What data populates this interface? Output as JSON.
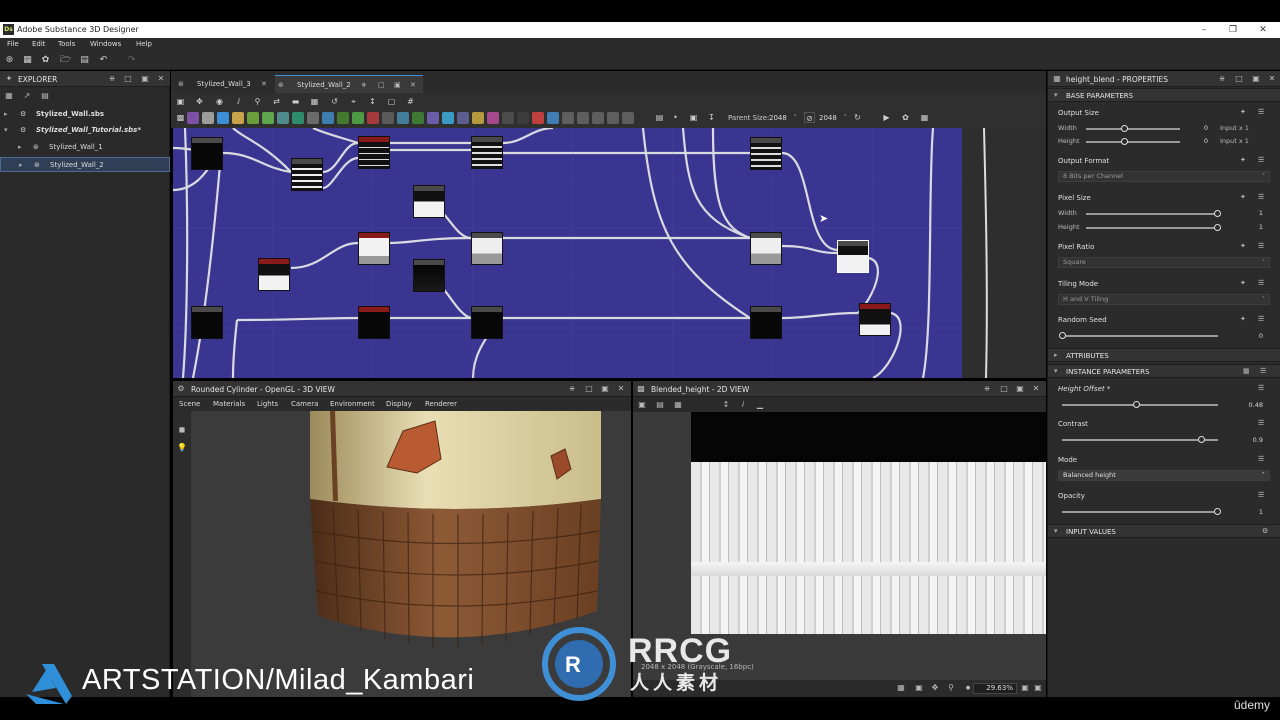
{
  "app": {
    "title": "Adobe Substance 3D Designer",
    "logo": "Ds"
  },
  "menu": [
    "File",
    "Edit",
    "Tools",
    "Windows",
    "Help"
  ],
  "explorer": {
    "title": "EXPLORER",
    "items": [
      {
        "label": "Stylized_Wall.sbs"
      },
      {
        "label": "Stylized_Wall_Tutorial.sbs*"
      },
      {
        "label": "Stylized_Wall_1"
      },
      {
        "label": "Stylized_Wall_2"
      }
    ]
  },
  "graph": {
    "tabs": [
      "Stylized_Wall_3",
      "Stylized_Wall_2"
    ],
    "parent_size_label": "Parent Size:",
    "parent_size_value": "2048",
    "size_value": "2048",
    "canvas_color": "#3a3590"
  },
  "view3d": {
    "title": "Rounded Cylinder - OpenGL - 3D VIEW",
    "menu": [
      "Scene",
      "Materials",
      "Lights",
      "Camera",
      "Environment",
      "Display",
      "Renderer"
    ]
  },
  "view2d": {
    "title": "Blended_height - 2D VIEW",
    "status": "2048 x 2048 (Grayscale, 16bpc)",
    "zoom": "29.63%"
  },
  "properties": {
    "title": "height_blend - PROPERTIES",
    "base_parameters": "BASE PARAMETERS",
    "output_size": {
      "label": "Output Size",
      "width_label": "Width",
      "width_value": "0",
      "width_mode": "Input x 1",
      "width_level": 0.5,
      "height_label": "Height",
      "height_value": "0",
      "height_mode": "Input x 1",
      "height_level": 0.5
    },
    "output_format": {
      "label": "Output Format",
      "value": "8 Bits per Channel"
    },
    "pixel_size": {
      "label": "Pixel Size",
      "width_label": "Width",
      "width_value": "1",
      "width_level": 1.0,
      "height_label": "Height",
      "height_value": "1",
      "height_level": 1.0
    },
    "pixel_ratio": {
      "label": "Pixel Ratio",
      "value": "Square"
    },
    "tiling_mode": {
      "label": "Tiling Mode",
      "value": "H and V Tiling"
    },
    "random_seed": {
      "label": "Random Seed",
      "value": "0",
      "level": 0.0
    },
    "attributes": "ATTRIBUTES",
    "instance_parameters": "INSTANCE PARAMETERS",
    "height_offset": {
      "label": "Height Offset *",
      "value": "0.48",
      "level": 0.48
    },
    "contrast": {
      "label": "Contrast",
      "value": "0.9",
      "level": 0.9
    },
    "mode": {
      "label": "Mode",
      "value": "Balanced height"
    },
    "opacity": {
      "label": "Opacity",
      "value": "1",
      "level": 1.0
    },
    "input_values": "INPUT VALUES"
  },
  "watermarks": {
    "artstation": "ARTSTATION/Milad_Kambari",
    "rrcg": "RRCG",
    "rrcg_sub": "人人素材",
    "udemy": "ûdemy"
  }
}
